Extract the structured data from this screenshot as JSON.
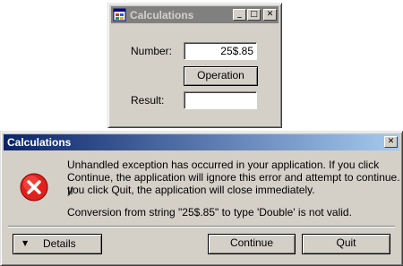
{
  "background_window": {
    "title": "Calculations",
    "minimize_glyph": "_",
    "maximize_glyph": "□",
    "close_glyph": "✕",
    "number_label": "Number:",
    "number_value": "25$.85",
    "operation_label": "Operation",
    "result_label": "Result:",
    "result_value": ""
  },
  "dialog": {
    "title": "Calculations",
    "close_glyph": "✕",
    "icon": "error-icon",
    "message_lines": [
      "Unhandled exception has occurred in your application. If you click",
      "Continue, the application will ignore this error and attempt to continue. If",
      "you click Quit, the application will close immediately."
    ],
    "detail": "Conversion from string \"25$.85\" to type 'Double' is not valid.",
    "details_arrow": "▼",
    "details_label": "Details",
    "continue_label": "Continue",
    "quit_label": "Quit"
  },
  "colors": {
    "face": "#d4d0c8",
    "title_active_start": "#0a246a",
    "title_active_end": "#a6caf0",
    "title_inactive": "#808080",
    "error_red": "#e0201c"
  }
}
